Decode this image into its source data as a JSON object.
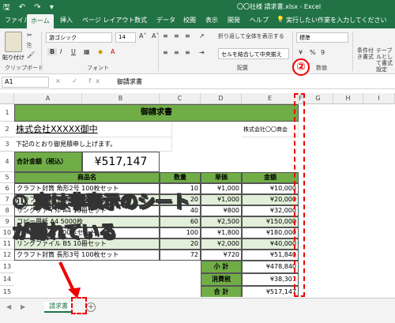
{
  "titlebar": {
    "quick_access": "🖫 ↶ ↷ ▾",
    "title": "〇〇社様 請求書.xlsx  -  Excel"
  },
  "tabs": [
    "ファイル",
    "ホーム",
    "挿入",
    "ページ レイアウト",
    "数式",
    "データ",
    "校閲",
    "表示",
    "開発",
    "ヘルプ"
  ],
  "tell_me": "実行したい作業を入力してください",
  "ribbon": {
    "paste_label": "貼り付け",
    "clipboard_label": "クリップボード",
    "font_name": "游ゴシック",
    "font_size": "14",
    "font_label": "フォント",
    "wrap_text": "折り返して全体を表示する",
    "merge_center": "セルを結合して中央揃え",
    "alignment_label": "配置",
    "number_format": "標準",
    "number_label": "数値",
    "conditional_format": "条件付き書式",
    "table_format": "テーブルとして書式設定",
    "bold": "B",
    "italic": "I",
    "underline": "U",
    "percent": "%",
    "comma": "9"
  },
  "formula": {
    "namebox": "A1",
    "fx": "× ✓ fx",
    "content": "御請求書"
  },
  "columns": [
    "A",
    "B",
    "C",
    "D",
    "E",
    "F",
    "G",
    "H",
    "I"
  ],
  "rows": [
    "1",
    "2",
    "3",
    "4",
    "5",
    "6",
    "7",
    "8",
    "9",
    "10",
    "11",
    "12",
    "13",
    "14",
    "15",
    "16"
  ],
  "sheet": {
    "title": "御請求書",
    "customer": "株式会社XXXXX御中",
    "issuer": "株式会社〇〇商会",
    "intro": "下記のとおり御見積申し上げます。",
    "total_label": "合計金額（税込）",
    "total_value": "¥517,147",
    "headers": [
      "商品名",
      "数量",
      "単価",
      "金額"
    ],
    "items": [
      {
        "name": "クラフト封筒 角形2号 100枚セット",
        "qty": "10",
        "price": "¥1,000",
        "amount": "¥10,000"
      },
      {
        "name": "クラフト封筒 長形3号 100枚セット",
        "qty": "20",
        "price": "¥1,000",
        "amount": "¥20,000"
      },
      {
        "name": "リングファイル A4 10冊セット",
        "qty": "40",
        "price": "¥800",
        "amount": "¥32,000"
      },
      {
        "name": "コピー用紙 A4 5000枚",
        "qty": "60",
        "price": "¥2,500",
        "amount": "¥150,000"
      },
      {
        "name": "ボールペン 黒 100本セット",
        "qty": "100",
        "price": "¥1,800",
        "amount": "¥180,000"
      },
      {
        "name": "リングファイル B5 10冊セット",
        "qty": "20",
        "price": "¥2,000",
        "amount": "¥40,000"
      },
      {
        "name": "クラフト封筒 長形3号 100枚セット",
        "qty": "72",
        "price": "¥720",
        "amount": "¥51,840"
      }
    ],
    "subtotal_label": "小 計",
    "subtotal": "¥478,840",
    "tax_label": "消費税",
    "tax": "¥38,307",
    "grand_label": "合 計",
    "grand": "¥517,147"
  },
  "sheet_tab": "請求書",
  "annotations": {
    "line1": "① 実は非表示のシート",
    "line2": "が隠れている",
    "marker2": "②"
  },
  "colors": {
    "excel_green": "#217346",
    "header_green": "#70ad47",
    "light_green": "#e2efda",
    "annotation_red": "#ee0000"
  }
}
